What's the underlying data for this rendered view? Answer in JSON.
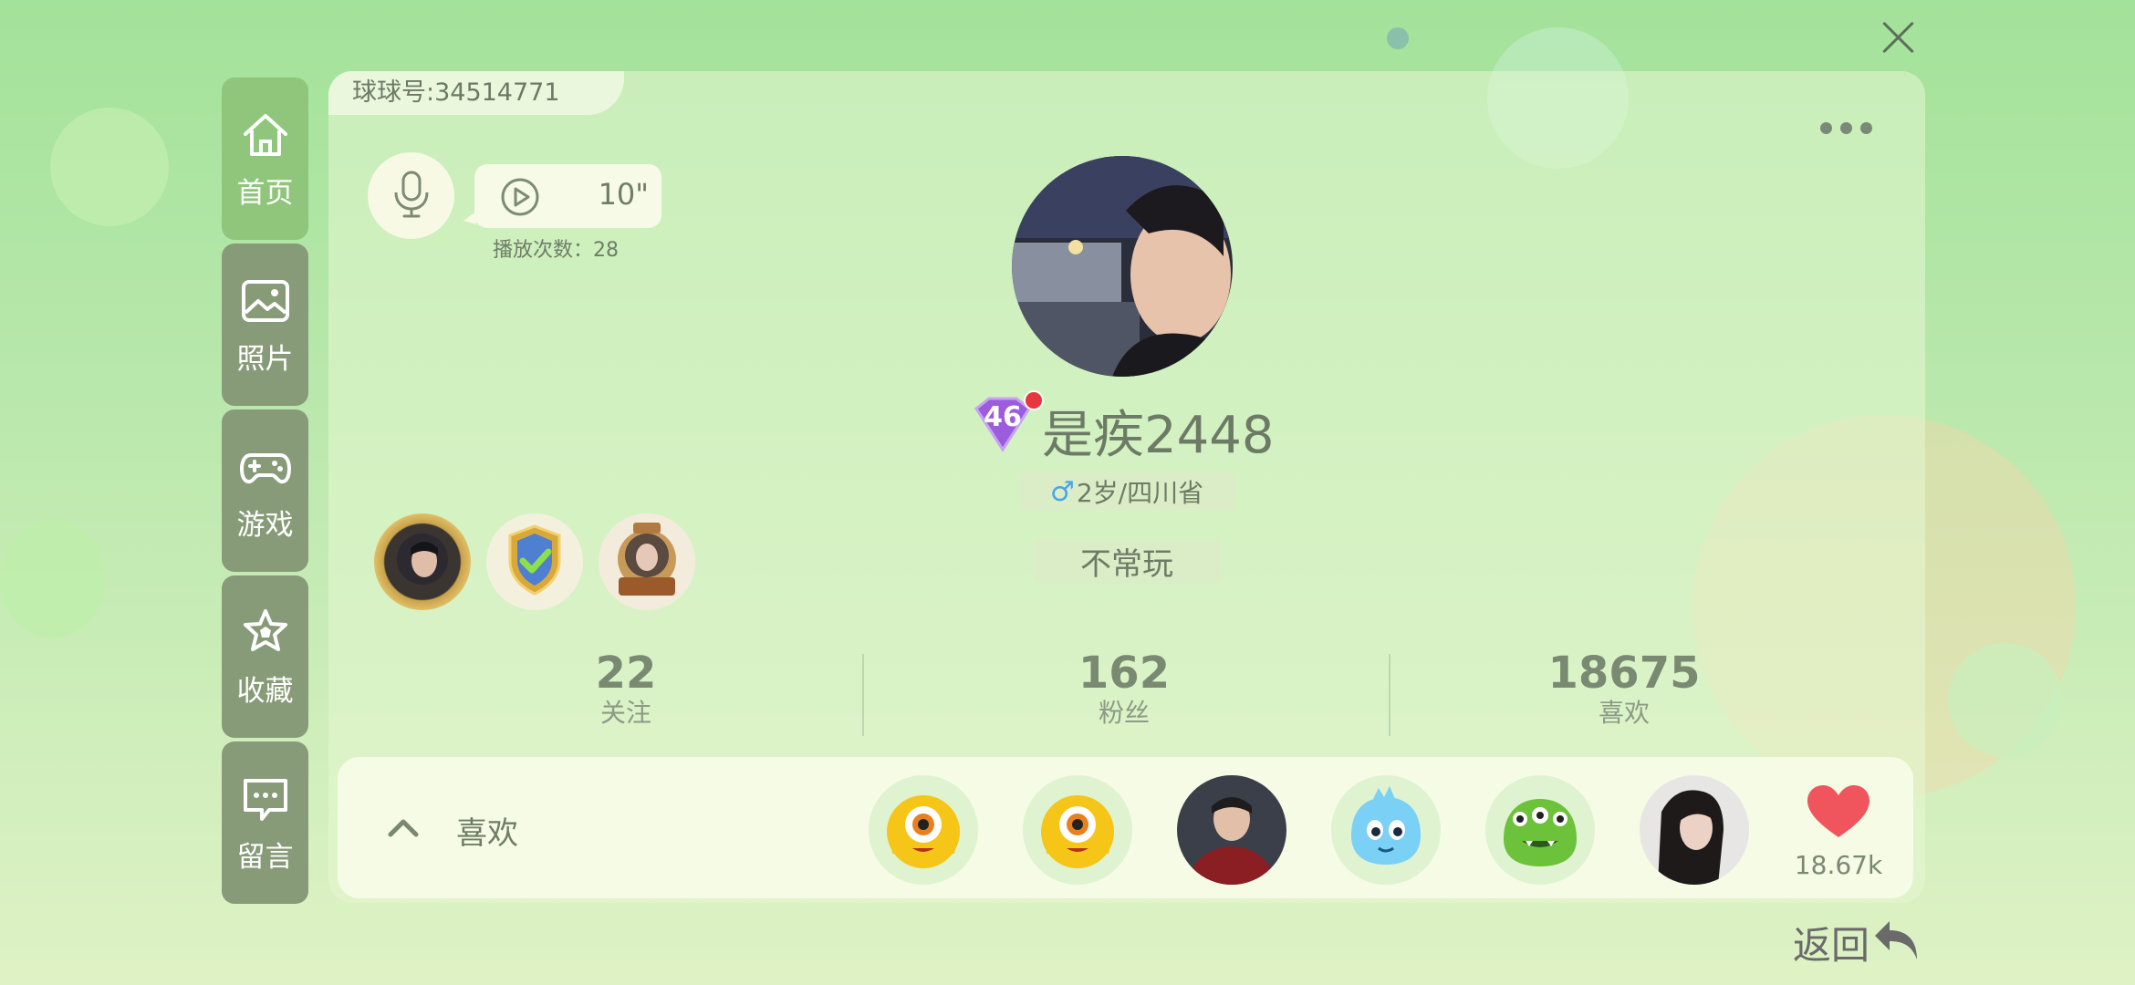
{
  "close": {
    "icon": "close-icon"
  },
  "sidebar": {
    "items": [
      {
        "label": "首页",
        "icon": "home-icon"
      },
      {
        "label": "照片",
        "icon": "photo-icon"
      },
      {
        "label": "游戏",
        "icon": "gamepad-icon"
      },
      {
        "label": "收藏",
        "icon": "star-icon"
      },
      {
        "label": "留言",
        "icon": "message-icon"
      }
    ]
  },
  "profile": {
    "id_label": "球球号:34514771",
    "voice": {
      "duration": "10\"",
      "play_count": "播放次数：28"
    },
    "level": "46",
    "username": "是疾2448",
    "gender_symbol": "♂",
    "info": "2岁/四川省",
    "status": "不常玩"
  },
  "stats": [
    {
      "value": "22",
      "label": "关注"
    },
    {
      "value": "162",
      "label": "粉丝"
    },
    {
      "value": "18675",
      "label": "喜欢"
    }
  ],
  "likes": {
    "label": "喜欢",
    "count": "18.67k"
  },
  "back": {
    "label": "返回"
  },
  "colors": {
    "sidebar_active": "#8fc67c",
    "sidebar_item": "#889b78",
    "heart": "#f0545c"
  }
}
